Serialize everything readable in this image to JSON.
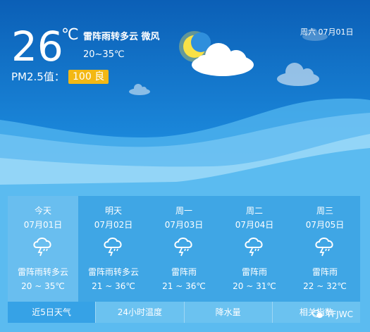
{
  "current": {
    "temp": "26",
    "unit": "℃",
    "condition": "雷阵雨转多云 微风",
    "range": "20~35℃",
    "pm_label": "PM2.5值：",
    "pm_badge": "100 良"
  },
  "date_top": "周六 07月01日",
  "forecast": [
    {
      "name": "今天",
      "date": "07月01日",
      "desc": "雷阵雨转多云",
      "range": "20 ~ 35℃",
      "icon": "thunderstorm-icon"
    },
    {
      "name": "明天",
      "date": "07月02日",
      "desc": "雷阵雨转多云",
      "range": "21 ~ 36℃",
      "icon": "thunderstorm-icon"
    },
    {
      "name": "周一",
      "date": "07月03日",
      "desc": "雷阵雨",
      "range": "21 ~ 36℃",
      "icon": "thunderstorm-icon"
    },
    {
      "name": "周二",
      "date": "07月04日",
      "desc": "雷阵雨",
      "range": "20 ~ 31℃",
      "icon": "thunderstorm-icon"
    },
    {
      "name": "周三",
      "date": "07月05日",
      "desc": "雷阵雨",
      "range": "22 ~ 32℃",
      "icon": "thunderstorm-icon"
    }
  ],
  "tabs": [
    "近5日天气",
    "24小时温度",
    "降水量",
    "相关指数"
  ],
  "watermark": "TFJWC",
  "colors": {
    "badge": "#f3b814",
    "sky_top": "#0b5fb6",
    "sky_bottom": "#5dbdf2"
  }
}
